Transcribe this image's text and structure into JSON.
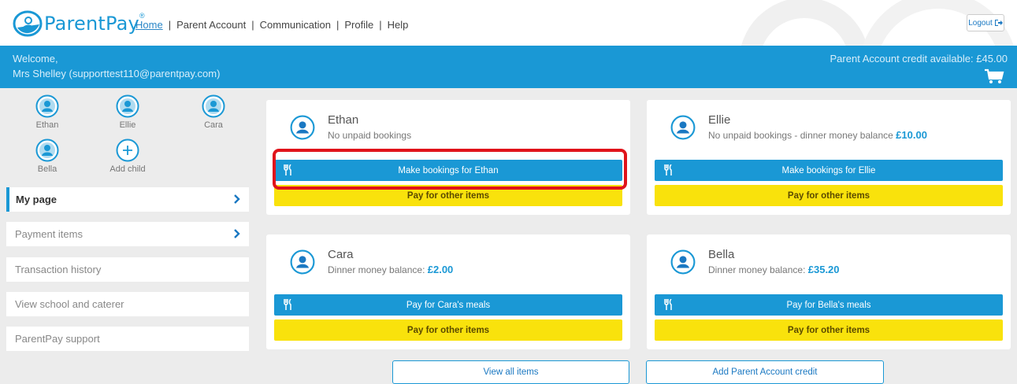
{
  "brand": {
    "name": "ParentPay",
    "reg": "®"
  },
  "nav": [
    {
      "label": "Home",
      "active": true
    },
    {
      "label": "Parent Account"
    },
    {
      "label": "Communication"
    },
    {
      "label": "Profile"
    },
    {
      "label": "Help"
    }
  ],
  "nav_separator": "|",
  "logout_label": "Logout",
  "banner": {
    "welcome": "Welcome,",
    "user": "Mrs Shelley (supporttest110@parentpay.com)",
    "credit": "Parent Account credit available: £45.00"
  },
  "children": [
    "Ethan",
    "Ellie",
    "Cara",
    "Bella"
  ],
  "add_child_label": "Add child",
  "menu": [
    {
      "label": "My page",
      "active": true,
      "chevron": true
    },
    {
      "label": "Payment items",
      "chevron": true
    },
    {
      "label": "Transaction history"
    },
    {
      "label": "View school and caterer"
    },
    {
      "label": "ParentPay support"
    }
  ],
  "cards": [
    {
      "name": "Ethan",
      "status": "No unpaid bookings",
      "amount": "",
      "action": "Make bookings for Ethan",
      "other": "Pay for other items"
    },
    {
      "name": "Ellie",
      "status": "No unpaid bookings - dinner money balance ",
      "amount": "£10.00",
      "action": "Make bookings for Ellie",
      "other": "Pay for other items"
    },
    {
      "name": "Cara",
      "status": "Dinner money balance: ",
      "amount": "£2.00",
      "action": "Pay for Cara's meals",
      "other": "Pay for other items"
    },
    {
      "name": "Bella",
      "status": "Dinner money balance: ",
      "amount": "£35.20",
      "action": "Pay for Bella's meals",
      "other": "Pay for other items"
    }
  ],
  "footer": {
    "view_all": "View all items",
    "add_credit": "Add Parent Account credit"
  },
  "colors": {
    "brand_blue": "#1a98d5",
    "yellow": "#f9e20c",
    "highlight_red": "#e0141b"
  }
}
